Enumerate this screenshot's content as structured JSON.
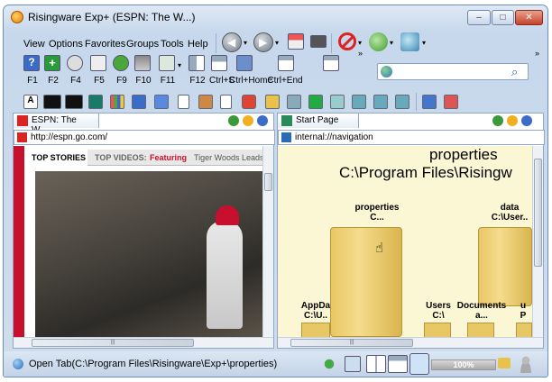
{
  "window": {
    "title": "Risingware Exp+  (ESPN: The W...)",
    "controls": {
      "minimize": "–",
      "maximize": "□",
      "close": "✕"
    }
  },
  "menu": [
    "View",
    "Options",
    "Favorites",
    "Groups",
    "Tools",
    "Help"
  ],
  "toolbar": {
    "fkeys": [
      "F1",
      "F2",
      "F4",
      "F5",
      "F9",
      "F10",
      "F11",
      "F12",
      "Ctrl+S",
      "Ctrl+Home",
      "Ctrl+End"
    ],
    "overflow": "»"
  },
  "search": {
    "placeholder": ""
  },
  "left_pane": {
    "tab_title": "ESPN: The W...",
    "address": "http://espn.go.com/",
    "tabs": {
      "top_stories": "TOP STORIES",
      "top_videos": "TOP VIDEOS:",
      "featuring": "Featuring",
      "headline": "Tiger Woods Leads U"
    },
    "photo_caption": ""
  },
  "right_pane": {
    "tab_title": "Start Page",
    "address": "internal://navigation",
    "heading_line1": "properties",
    "heading_line2": "C:\\Program Files\\Risingw",
    "folders": [
      {
        "name": "properties",
        "path": "C..."
      },
      {
        "name": "data",
        "path": "C:\\User.."
      },
      {
        "name": "AppDa",
        "path": "C:\\U.."
      },
      {
        "name": "Users",
        "path": "C:\\"
      },
      {
        "name": "Documents",
        "path": "a..."
      },
      {
        "name": "u",
        "path": "P"
      }
    ]
  },
  "status": {
    "text": "Open Tab(C:\\Program Files\\Risingware\\Exp+\\properties)",
    "zoom": "100%"
  },
  "scroll": {
    "left_h_marks": "|||",
    "right_h_marks": "|||"
  }
}
